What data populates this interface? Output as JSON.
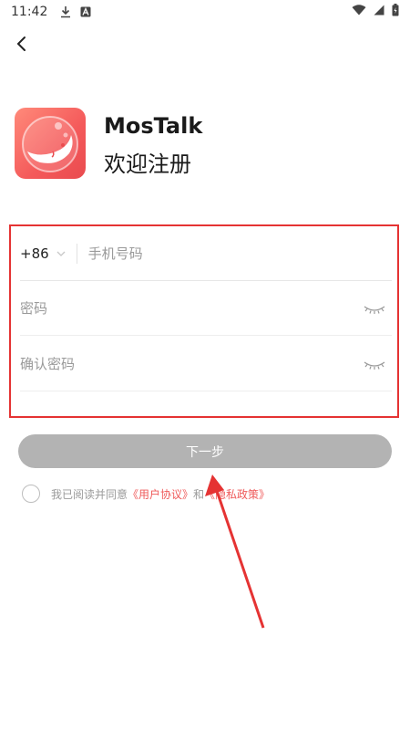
{
  "status_bar": {
    "time": "11:42",
    "icons": [
      "download-icon",
      "a-icon",
      "wifi-icon",
      "signal-icon",
      "battery-icon"
    ]
  },
  "header": {
    "back_icon": "chevron-left-icon"
  },
  "brand": {
    "app_name": "MosTalk",
    "welcome": "欢迎注册",
    "logo_colors": [
      "#ff8a7a",
      "#e94b4f"
    ]
  },
  "form": {
    "country_code": "+86",
    "phone_placeholder": "手机号码",
    "password_placeholder": "密码",
    "confirm_placeholder": "确认密码",
    "eye_icon": "eye-closed-icon"
  },
  "actions": {
    "next_label": "下一步",
    "next_color": "#b3b3b3"
  },
  "agreement": {
    "prefix": "我已阅读并同意",
    "user_agreement": "《用户协议》",
    "and": "和",
    "privacy_policy": "《隐私政策》",
    "link_color": "#ef5a5a"
  },
  "annotation_color": "#e53333"
}
